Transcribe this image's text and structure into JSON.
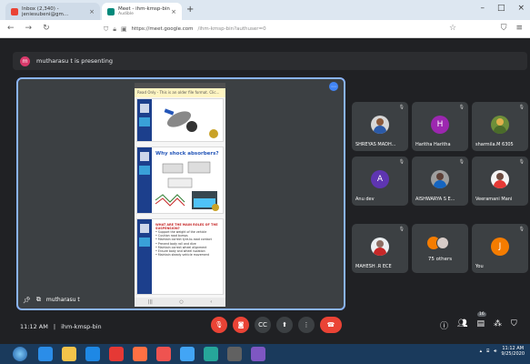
{
  "browser": {
    "tabs": [
      {
        "title": "Inbox (2,340) - jeniesubeni@gm...",
        "active": false
      },
      {
        "title": "Meet - ihm-kmsp-bin",
        "subtitle": "Audible",
        "active": true
      }
    ],
    "url_host": "https://meet.google.com",
    "url_path": "/ihm-kmsp-bin?authuser=0"
  },
  "meet": {
    "presenting_initial": "m",
    "presenting_text": "mutharasu t is presenting",
    "presenter_name": "mutharasu t",
    "time": "11:12 AM",
    "separator": "|",
    "meeting_code": "ihm-kmsp-bin",
    "participant_count": "16",
    "participants": [
      {
        "name": "SHREYAS MADH...",
        "type": "photo"
      },
      {
        "name": "Haritha Haritha",
        "type": "initial",
        "initial": "H",
        "color": "#9c27b0"
      },
      {
        "name": "sharmila.M 6305",
        "type": "photo"
      },
      {
        "name": "Anu dev",
        "type": "initial",
        "initial": "A",
        "color": "#5e35b1"
      },
      {
        "name": "AISHWARYA S E...",
        "type": "photo"
      },
      {
        "name": "Veeramani Mani",
        "type": "photo"
      },
      {
        "name": "MAHESH .R ECE",
        "type": "photo"
      },
      {
        "name": "75 others",
        "type": "group"
      },
      {
        "name": "You",
        "type": "initial",
        "initial": "J",
        "color": "#f57c00"
      }
    ]
  },
  "shared_doc": {
    "readonly_text": "Read Only - This is an older file format. Clic...",
    "slide2_title": "Why shock absorbers?",
    "slide3_title": "WHAT ARE THE MAIN ROLES OF THE SUSPENSION?",
    "slide3_bullets": [
      "Support the weight of the vehicle",
      "Cushion road bumps",
      "Maintain correct tyre-to-road contact",
      "Prevent body roll and dive",
      "Maintain correct wheel alignment",
      "Ensure body and wheel isolation",
      "Maintain steady vehicle movement"
    ]
  },
  "taskbar": {
    "clock_time": "11:12 AM",
    "clock_date": "9/25/2020"
  }
}
